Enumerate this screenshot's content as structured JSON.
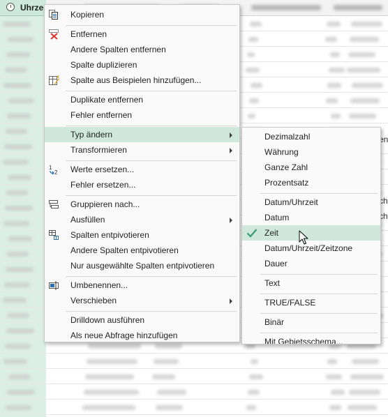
{
  "grid": {
    "selected_column_header": "Uhrzeit",
    "peek_labels": [
      "en",
      "ch",
      "ch"
    ]
  },
  "context_menu": {
    "items": [
      {
        "label": "Kopieren",
        "icon": "copy-icon"
      },
      {
        "label": "Entfernen",
        "icon": "remove-columns-icon"
      },
      {
        "label": "Andere Spalten entfernen"
      },
      {
        "label": "Spalte duplizieren"
      },
      {
        "label": "Spalte aus Beispielen hinzufügen...",
        "icon": "column-from-examples-icon"
      },
      {
        "label": "Duplikate entfernen"
      },
      {
        "label": "Fehler entfernen"
      },
      {
        "label": "Typ ändern",
        "submenu": true,
        "highlighted": true
      },
      {
        "label": "Transformieren",
        "submenu": true
      },
      {
        "label": "Werte ersetzen...",
        "icon": "replace-values-icon"
      },
      {
        "label": "Fehler ersetzen..."
      },
      {
        "label": "Gruppieren nach...",
        "icon": "group-by-icon"
      },
      {
        "label": "Ausfüllen",
        "submenu": true
      },
      {
        "label": "Spalten entpivotieren",
        "icon": "unpivot-icon"
      },
      {
        "label": "Andere Spalten entpivotieren"
      },
      {
        "label": "Nur ausgewählte Spalten entpivotieren"
      },
      {
        "label": "Umbenennen...",
        "icon": "rename-icon"
      },
      {
        "label": "Verschieben",
        "submenu": true
      },
      {
        "label": "Drilldown ausführen"
      },
      {
        "label": "Als neue Abfrage hinzufügen"
      }
    ]
  },
  "type_submenu": {
    "items": [
      {
        "label": "Dezimalzahl"
      },
      {
        "label": "Währung"
      },
      {
        "label": "Ganze Zahl"
      },
      {
        "label": "Prozentsatz"
      },
      {
        "label": "Datum/Uhrzeit"
      },
      {
        "label": "Datum"
      },
      {
        "label": "Zeit",
        "checked": true,
        "highlighted": true
      },
      {
        "label": "Datum/Uhrzeit/Zeitzone"
      },
      {
        "label": "Dauer"
      },
      {
        "label": "Text"
      },
      {
        "label": "TRUE/FALSE"
      },
      {
        "label": "Binär"
      },
      {
        "label": "Mit Gebietsschema..."
      }
    ]
  },
  "colors": {
    "accent": "#5cb88f",
    "highlight": "#cfe8db",
    "selected_column": "#dcefe5"
  }
}
